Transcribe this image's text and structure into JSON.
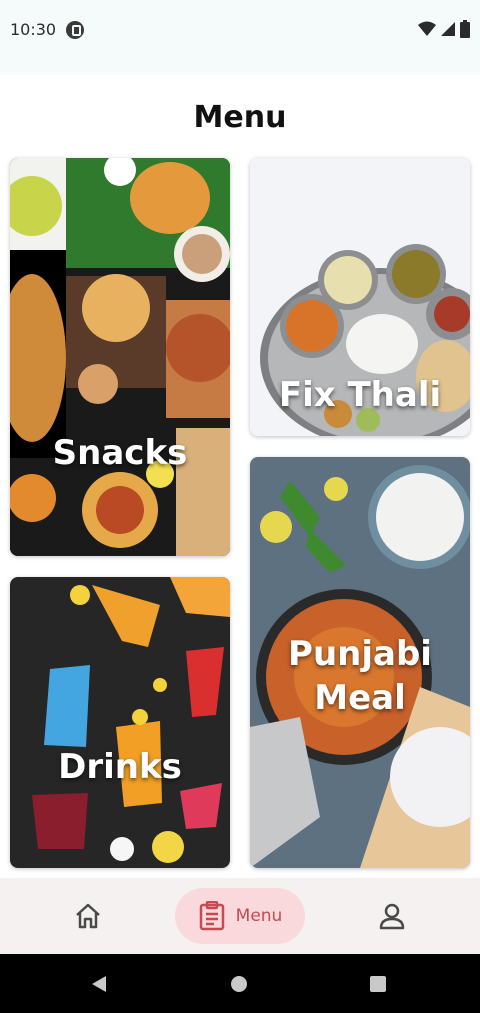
{
  "status": {
    "time": "10:30"
  },
  "page": {
    "title": "Menu"
  },
  "cards": {
    "snacks": {
      "label": "Snacks"
    },
    "thali": {
      "label": "Fix Thali"
    },
    "drinks": {
      "label": "Drinks"
    },
    "punjabi": {
      "label": "Punjabi Meal"
    }
  },
  "bottom_nav": {
    "items": [
      {
        "icon": "home-icon"
      },
      {
        "icon": "menu-clipboard-icon",
        "label": "Menu",
        "active": true
      },
      {
        "icon": "profile-icon"
      }
    ],
    "active_color": "#c74a52",
    "active_bg": "#f9d9db"
  }
}
